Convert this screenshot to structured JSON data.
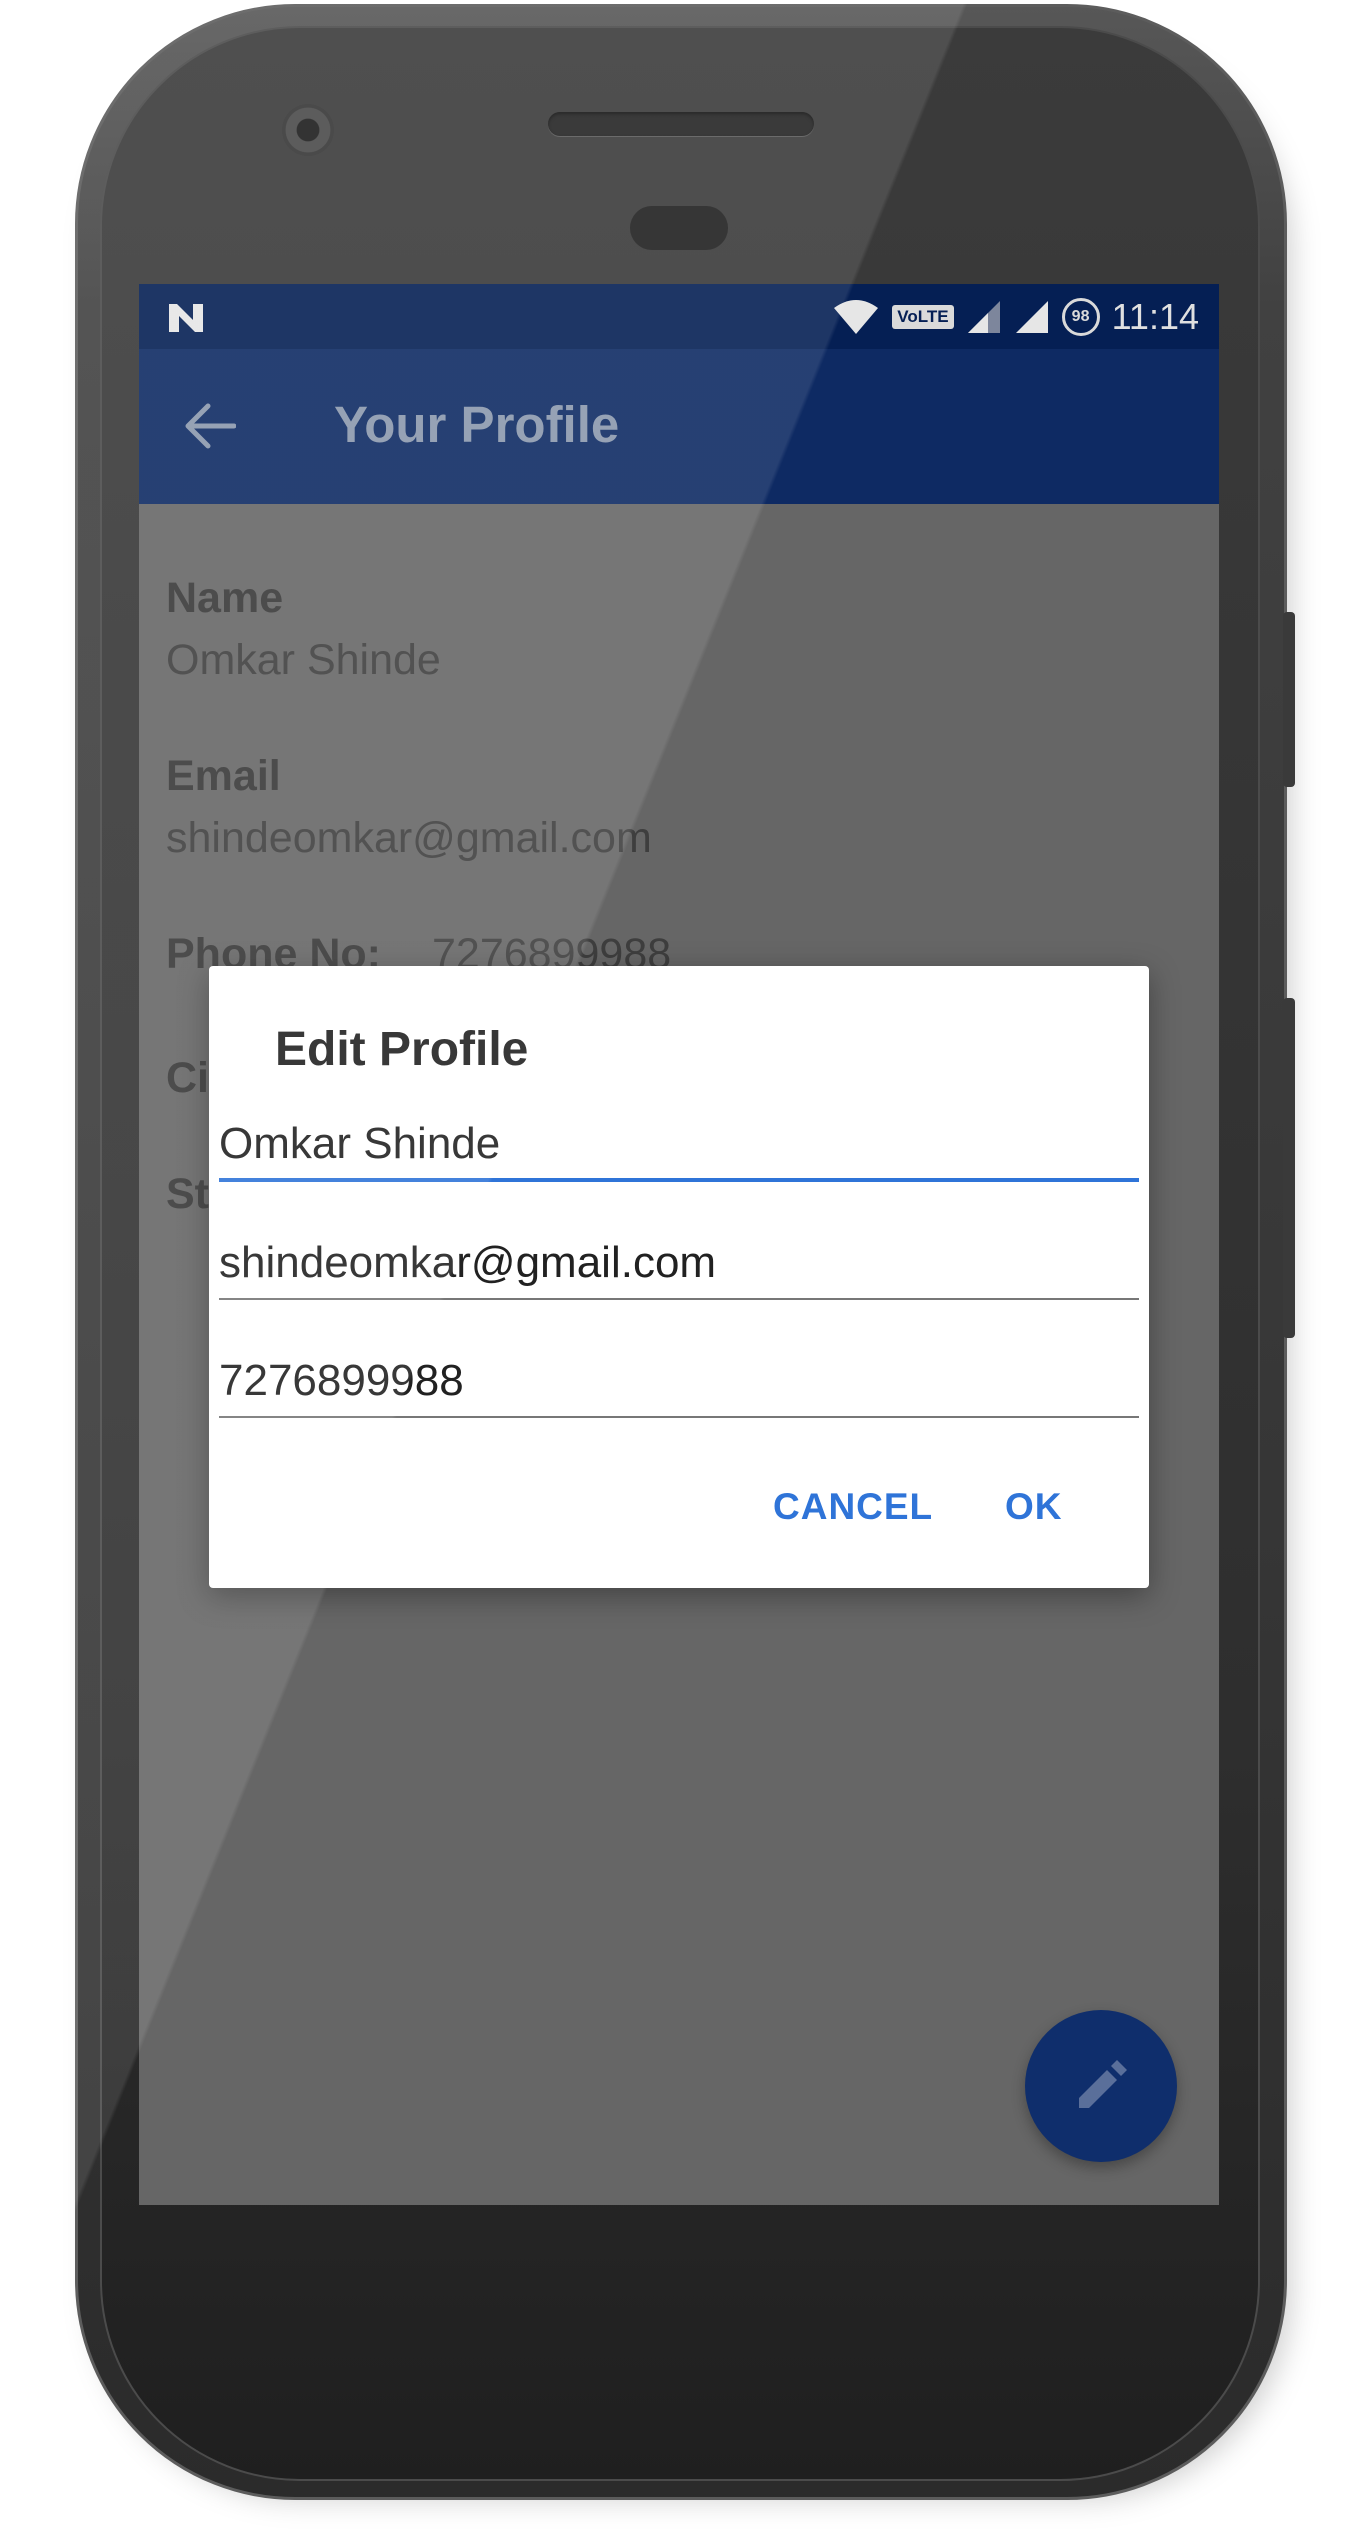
{
  "status_bar": {
    "carrier_badge": "VoLTE",
    "battery_level": "98",
    "time": "11:14",
    "icons": [
      "n-logo-icon",
      "wifi-icon",
      "signal-icon",
      "signal-icon",
      "battery-icon"
    ]
  },
  "toolbar": {
    "back_icon": "arrow-left-icon",
    "title": "Your Profile"
  },
  "profile": {
    "name_label": "Name",
    "name_value": "Omkar Shinde",
    "email_label": "Email",
    "email_value": "shindeomkar@gmail.com",
    "phone_label": "Phone No:",
    "phone_value": "7276899988",
    "city_label": "Ci",
    "state_label": "St"
  },
  "dialog": {
    "title": "Edit Profile",
    "name_input_value": "Omkar Shinde",
    "email_input_value": "shindeomkar@gmail.com",
    "phone_input_value": "7276899988",
    "cancel_label": "CANCEL",
    "ok_label": "OK"
  },
  "fab": {
    "icon": "pencil-icon"
  },
  "colors": {
    "status_bar": "#051f54",
    "toolbar": "#0e2a63",
    "accent": "#2f74d8",
    "fab": "#0f2e6c",
    "scrim": "#666666"
  }
}
